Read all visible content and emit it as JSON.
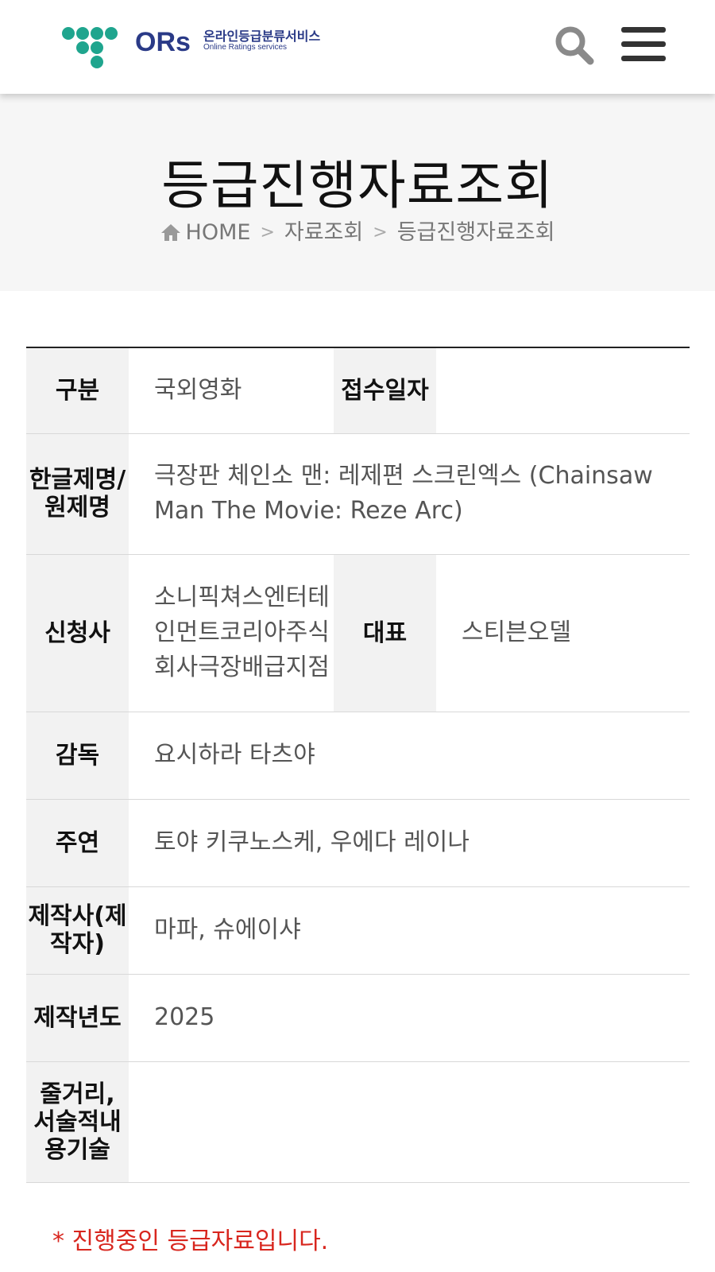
{
  "header": {
    "logo_text": "ORs",
    "logo_kor": "온라인등급분류서비스",
    "logo_eng": "Online Ratings services",
    "search_icon": "search-icon",
    "menu_icon": "hamburger-menu-icon"
  },
  "page": {
    "title": "등급진행자료조회",
    "breadcrumb": [
      "HOME",
      "자료조회",
      "등급진행자료조회"
    ]
  },
  "table": {
    "category_label": "구분",
    "category_value": "국외영화",
    "receipt_date_label": "접수일자",
    "receipt_date_value": "",
    "title_label": "한글제명/원제명",
    "title_value": "극장판 체인소 맨: 레제편 스크린엑스 (Chainsaw Man The Movie: Reze Arc)",
    "applicant_label": "신청사",
    "applicant_value": "소니픽쳐스엔터테인먼트코리아주식회사극장배급지점",
    "representative_label": "대표",
    "representative_value": "스티븐오델",
    "director_label": "감독",
    "director_value": "요시하라 타츠야",
    "cast_label": "주연",
    "cast_value": "토야 키쿠노스케, 우에다 레이나",
    "producer_label": "제작사(제작자)",
    "producer_value": "마파, 슈에이샤",
    "year_label": "제작년도",
    "year_value": "2025",
    "synopsis_label": "줄거리, 서술적내용기술",
    "synopsis_value": ""
  },
  "notice": "* 진행중인 등급자료입니다.",
  "colors": {
    "brand_green": "#1fa58e",
    "brand_navy": "#2a3a87",
    "notice_red": "#d8261e"
  }
}
